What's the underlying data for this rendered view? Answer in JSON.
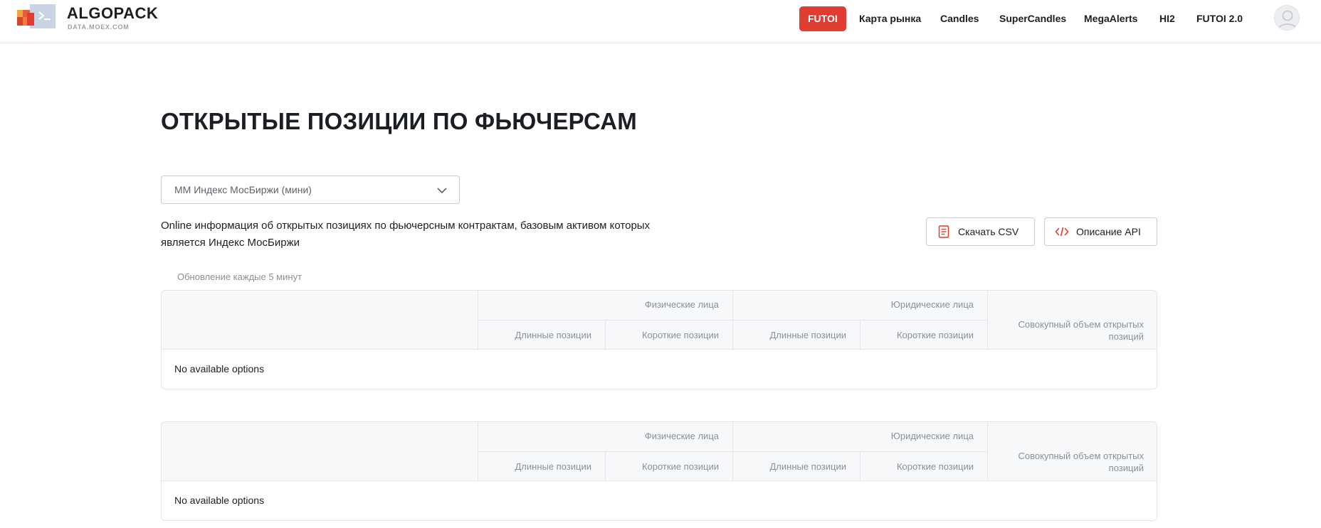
{
  "header": {
    "brand_title": "ALGOPACK",
    "brand_subtitle": "DATA.MOEX.COM",
    "nav": [
      "FUTOI",
      "Карта рынка",
      "Candles",
      "SuperCandles",
      "MegaAlerts",
      "HI2",
      "FUTOI 2.0"
    ],
    "active_nav": "FUTOI",
    "accent_color": "#e03c31"
  },
  "main": {
    "title": "ОТКРЫТЫЕ ПОЗИЦИИ ПО ФЬЮЧЕРСАМ",
    "select_value": "MM Индекс МосБиржи (мини)",
    "description_line1": "Online информация об открытых позициях по фьючерсным контрактам, базовым активом которых",
    "description_line2": "является Индекс МосБиржи",
    "download_csv": "Скачать CSV",
    "api_description": "Описание API",
    "update_note": "Обновление каждые 5 минут"
  },
  "tables": [
    {
      "group_physical": "Физические лица",
      "group_legal": "Юридические лица",
      "long_positions": "Длинные позиции",
      "short_positions": "Короткие позиции",
      "total_line1": "Совокупный объем открытых",
      "total_line2": "позиций",
      "empty_text": "No available options"
    },
    {
      "group_physical": "Физические лица",
      "group_legal": "Юридические лица",
      "long_positions": "Длинные позиции",
      "short_positions": "Короткие позиции",
      "total_line1": "Совокупный объем открытых",
      "total_line2": "позиций",
      "empty_text": "No available options"
    }
  ]
}
